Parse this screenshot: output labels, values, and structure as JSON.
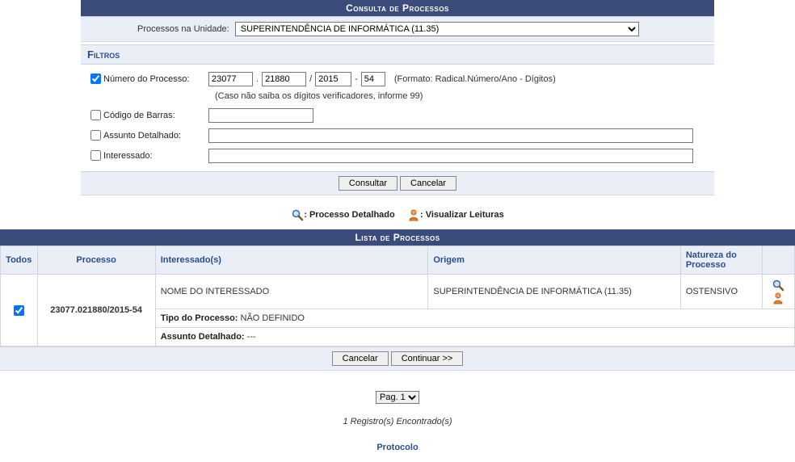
{
  "header": {
    "title": "Consulta de Processos",
    "unit_label": "Processos na Unidade:",
    "unit_value": "SUPERINTENDÊNCIA DE INFORMÁTICA (11.35)"
  },
  "filters": {
    "section_title": "Filtros",
    "rows": {
      "numero": {
        "label": "Número do Processo:",
        "radical": "23077",
        "numero": "21880",
        "ano": "2015",
        "digitos": "54",
        "format_hint": "(Formato: Radical.Número/Ano - Dígitos)",
        "hint2": "(Caso não saiba os dígitos verificadores, informe 99)"
      },
      "barras": {
        "label": "Código de Barras:",
        "value": ""
      },
      "assunto": {
        "label": "Assunto Detalhado:",
        "value": ""
      },
      "interessado": {
        "label": "Interessado:",
        "value": ""
      }
    },
    "buttons": {
      "consultar": "Consultar",
      "cancelar": "Cancelar"
    }
  },
  "legend": {
    "detalhado": ": Processo Detalhado",
    "leituras": ": Visualizar Leituras"
  },
  "list": {
    "title": "Lista de Processos",
    "headers": {
      "todos": "Todos",
      "processo": "Processo",
      "interessados": "Interessado(s)",
      "origem": "Origem",
      "natureza": "Natureza do Processo"
    },
    "row": {
      "processo": "23077.021880/2015-54",
      "interessado": "NOME DO INTERESSADO",
      "origem": "SUPERINTENDÊNCIA DE INFORMÁTICA (11.35)",
      "natureza": "OSTENSIVO",
      "tipo_label": "Tipo do Processo:",
      "tipo_value": " NÃO DEFINIDO",
      "assunto_label": "Assunto Detalhado:",
      "assunto_value": " ---"
    },
    "actions": {
      "cancelar": "Cancelar",
      "continuar": "Continuar >>"
    }
  },
  "pager": {
    "page_label": "Pag. 1",
    "count": "1 Registro(s) Encontrado(s)"
  },
  "footer": {
    "protocolo": "Protocolo"
  }
}
